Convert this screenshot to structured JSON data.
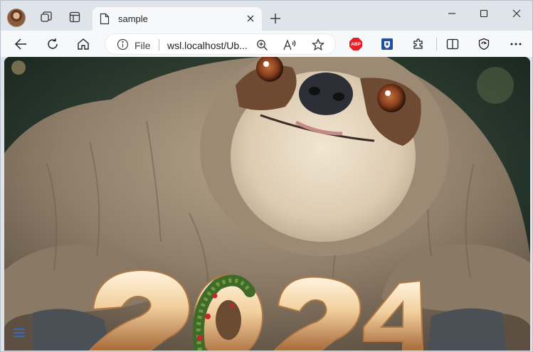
{
  "browser": {
    "tab": {
      "title": "sample"
    },
    "address_bar": {
      "scheme_label": "File",
      "url": "wsl.localhost/Ub..."
    },
    "extensions": {
      "adblock_label": "ABP"
    }
  },
  "page": {
    "image": {
      "subject": "sloth",
      "year_text": "2024"
    }
  },
  "colors": {
    "titlebar_bg": "#dfe4ea",
    "toolbar_bg": "#f7f8fa",
    "abp_red": "#e4212b",
    "hamburger_blue": "#2f6fd6"
  },
  "icons": [
    "avatar",
    "workspaces-icon",
    "tab-actions-icon",
    "page-icon",
    "close-icon",
    "plus-icon",
    "minimize-icon",
    "maximize-icon",
    "window-close-icon",
    "back-icon",
    "refresh-icon",
    "home-icon",
    "info-icon",
    "zoom-icon",
    "read-aloud-icon",
    "favorite-star-icon",
    "adblock-icon",
    "shield-extension-icon",
    "extensions-puzzle-icon",
    "split-screen-icon",
    "browser-essentials-icon",
    "more-icon",
    "hamburger-menu-icon"
  ]
}
